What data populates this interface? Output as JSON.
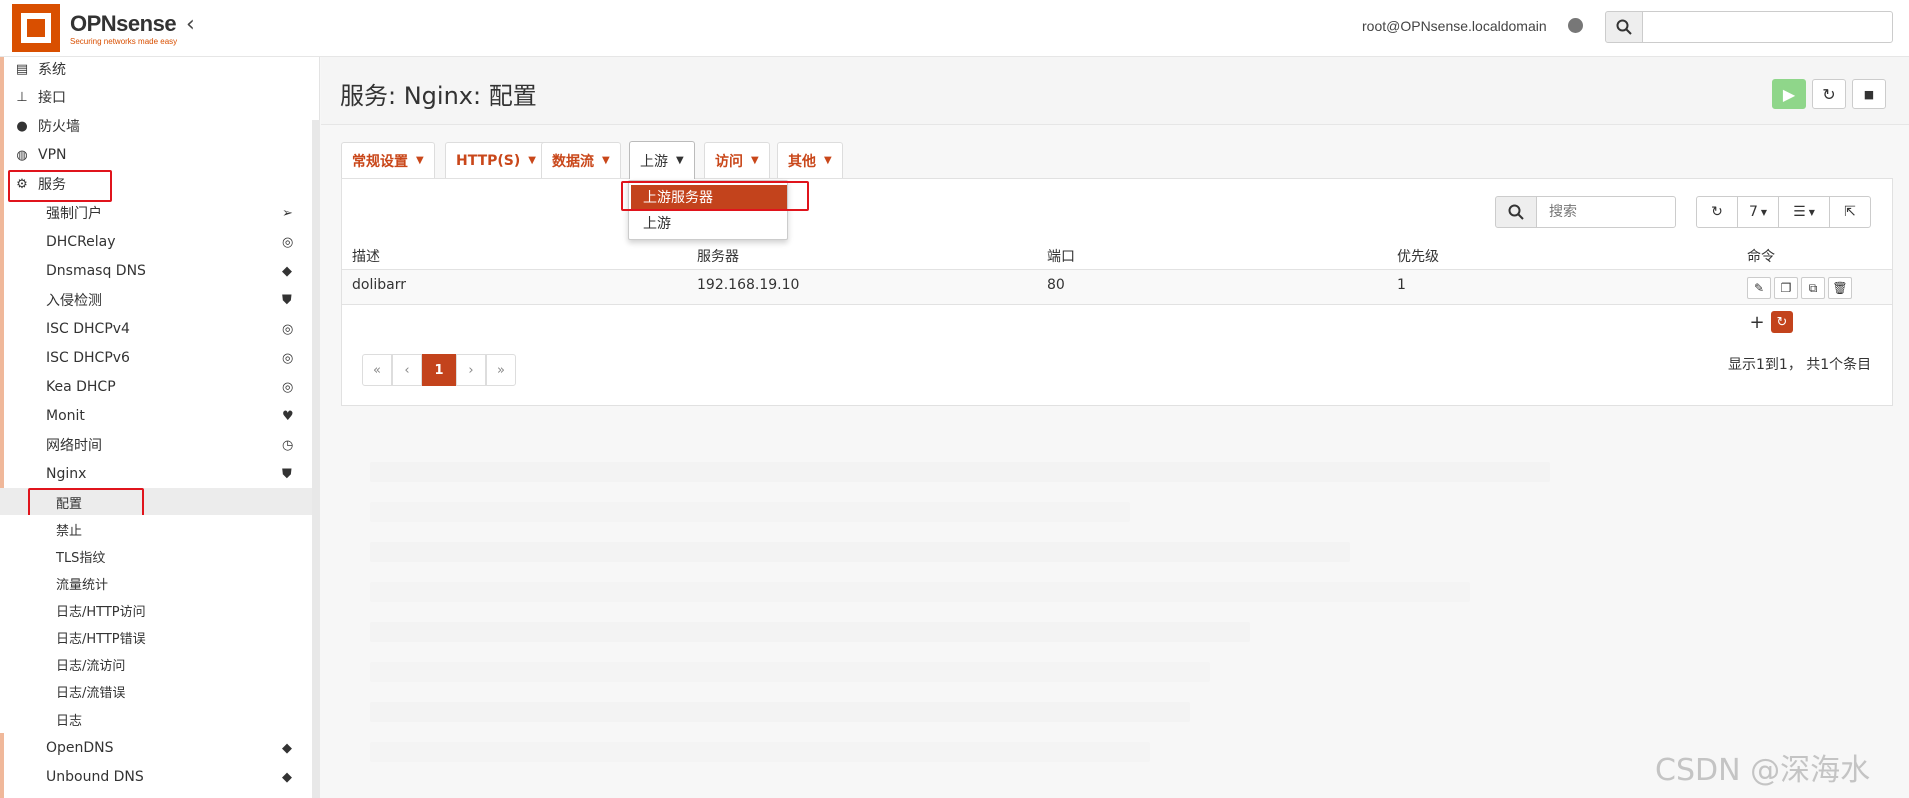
{
  "header": {
    "brand": "OPNsense",
    "tagline": "Securing networks made easy",
    "user": "root@OPNsense.localdomain",
    "search_placeholder": ""
  },
  "sidebar": {
    "top_items": [
      {
        "label": "系统",
        "icon": "server-icon"
      },
      {
        "label": "接口",
        "icon": "sitemap-icon"
      },
      {
        "label": "防火墙",
        "icon": "fire-icon"
      },
      {
        "label": "VPN",
        "icon": "globe-icon"
      },
      {
        "label": "服务",
        "icon": "gear-icon"
      }
    ],
    "services": [
      {
        "label": "强制门户",
        "icon": "paper-plane-icon"
      },
      {
        "label": "DHCRelay",
        "icon": "bullseye-icon"
      },
      {
        "label": "Dnsmasq DNS",
        "icon": "tags-icon"
      },
      {
        "label": "入侵检测",
        "icon": "shield-icon"
      },
      {
        "label": "ISC DHCPv4",
        "icon": "bullseye-icon"
      },
      {
        "label": "ISC DHCPv6",
        "icon": "bullseye-icon"
      },
      {
        "label": "Kea DHCP",
        "icon": "bullseye-icon"
      },
      {
        "label": "Monit",
        "icon": "heartbeat-icon"
      },
      {
        "label": "网络时间",
        "icon": "clock-icon"
      },
      {
        "label": "Nginx",
        "icon": "shield-icon"
      }
    ],
    "nginx_sub": [
      {
        "label": "配置"
      },
      {
        "label": "禁止"
      },
      {
        "label": "TLS指纹"
      },
      {
        "label": "流量统计"
      },
      {
        "label": "日志/HTTP访问"
      },
      {
        "label": "日志/HTTP错误"
      },
      {
        "label": "日志/流访问"
      },
      {
        "label": "日志/流错误"
      },
      {
        "label": "日志"
      }
    ],
    "after": [
      {
        "label": "OpenDNS",
        "icon": "tags-icon"
      },
      {
        "label": "Unbound DNS",
        "icon": "tags-icon"
      }
    ]
  },
  "page": {
    "title": "服务: Nginx: 配置"
  },
  "tabs": [
    {
      "label": "常规设置"
    },
    {
      "label": "HTTP(S)"
    },
    {
      "label": "数据流"
    },
    {
      "label": "上游"
    },
    {
      "label": "访问"
    },
    {
      "label": "其他"
    }
  ],
  "dropdown": {
    "items": [
      "上游服务器",
      "上游"
    ]
  },
  "grid": {
    "search_placeholder": "搜索",
    "rows_per_page": "7",
    "columns": [
      "描述",
      "服务器",
      "端口",
      "优先级",
      "命令"
    ],
    "rows": [
      {
        "desc": "dolibarr",
        "server": "192.168.19.10",
        "port": "80",
        "priority": "1"
      }
    ],
    "pagination": {
      "first": "«",
      "prev": "‹",
      "current": "1",
      "next": "›",
      "last": "»"
    },
    "info": "显示1到1， 共1个条目"
  },
  "watermark": "CSDN @深海水",
  "colors": {
    "accent": "#c3431c",
    "brand": "#d94f00",
    "highlight_box": "#e0141c",
    "play": "#8fd68a"
  }
}
